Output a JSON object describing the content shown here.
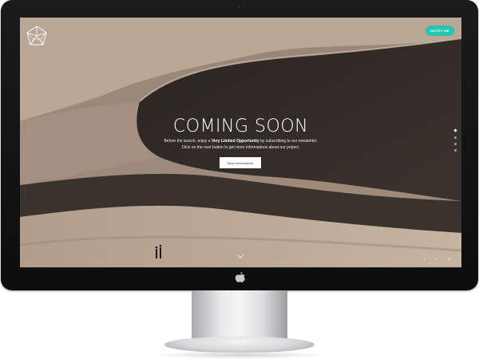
{
  "header": {
    "logo_icon": "geometric-polyhedron-logo",
    "notify_label": "NOTIFY ME",
    "notify_color": "#27c6b0"
  },
  "hero": {
    "title": "COMING SOON",
    "line1_prefix": "Before the launch, enjoy a ",
    "line1_bold": "Very Limited Opportunity",
    "line1_suffix": " by subscribing to our newsletter.",
    "line2": "Click on the next button to get more informations about our project.",
    "more_button": "More informations"
  },
  "navigation": {
    "section_dots": 4,
    "active_index": 0,
    "scroll_icon": "chevron-down-icon"
  },
  "social": {
    "facebook": "f",
    "twitter": "t",
    "linkedin": "in"
  },
  "device": {
    "brand_icon": "apple-logo-icon"
  }
}
